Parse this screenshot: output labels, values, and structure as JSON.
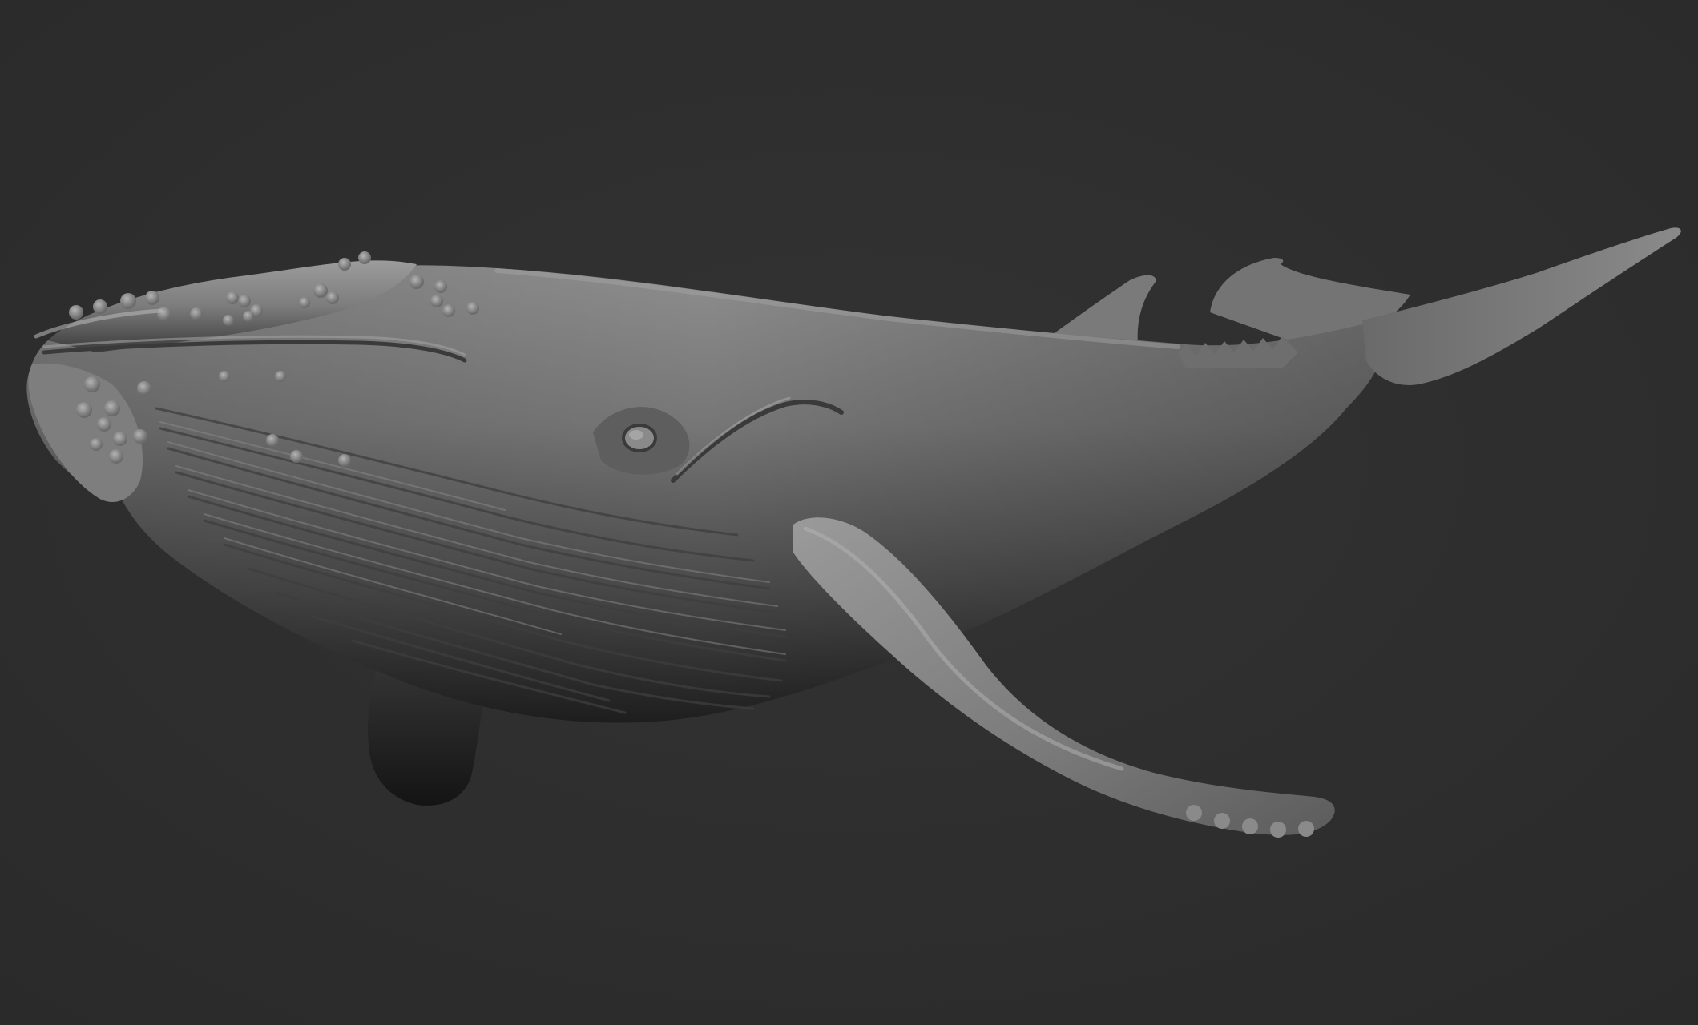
{
  "scene": {
    "subject": "humpback-whale-sculpt",
    "colors": {
      "background": "#2e2e2e",
      "body_mid": "#6e6e6e",
      "body_light": "#9a9a9a",
      "body_dark": "#2a2a2a",
      "fin_light": "#8c8c8c"
    }
  }
}
